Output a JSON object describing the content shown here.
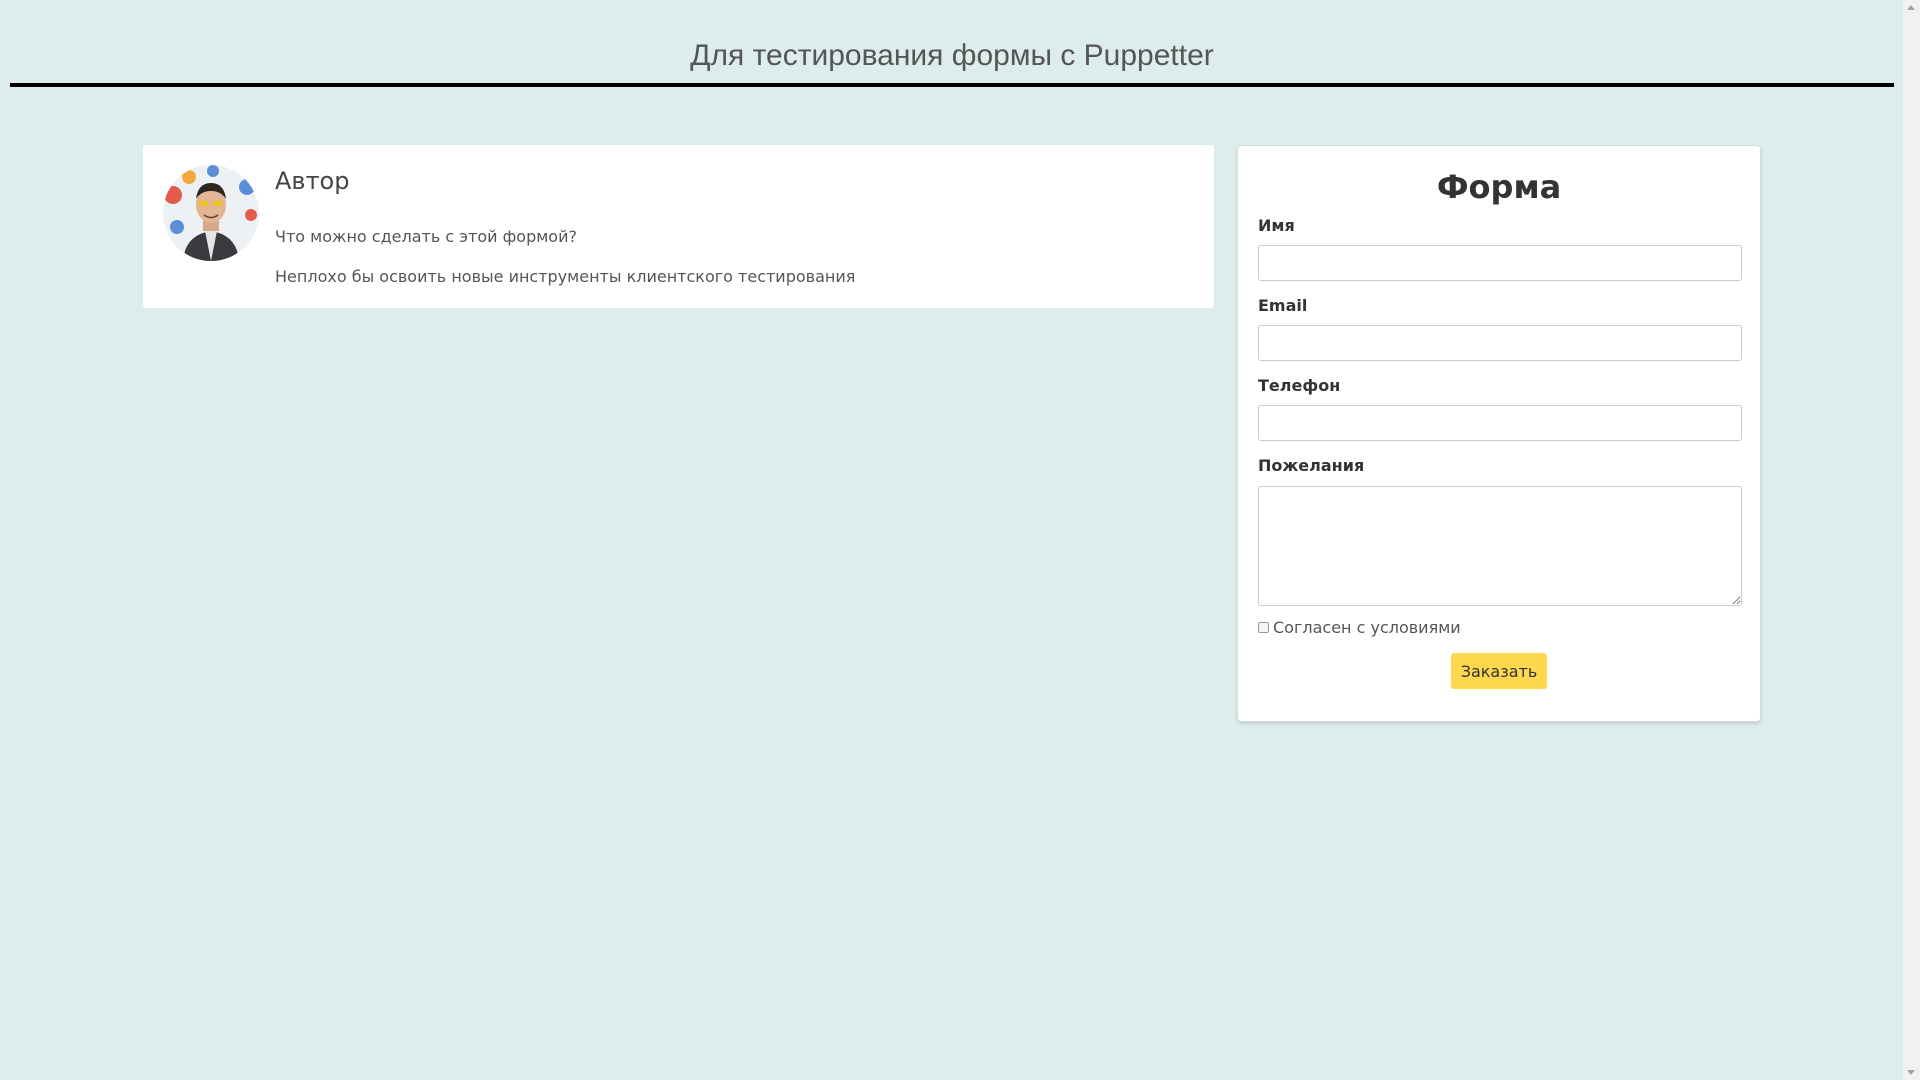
{
  "header": {
    "title": "Для тестирования формы с Puppetter"
  },
  "author": {
    "name": "Автор",
    "question": "Что можно сделать с этой формой?",
    "answer": "Неплохо бы освоить новые инструменты клиентского тестирования"
  },
  "form": {
    "title": "Форма",
    "name_label": "Имя",
    "name_value": "",
    "email_label": "Email",
    "email_value": "",
    "phone_label": "Телефон",
    "phone_value": "",
    "wishes_label": "Пожелания",
    "wishes_value": "",
    "consent_label": "Согласен с условиями",
    "consent_checked": false,
    "submit_label": "Заказать"
  },
  "colors": {
    "page_background": "#dcedec",
    "accent_button": "#fdd84e",
    "header_rule": "#000000"
  }
}
